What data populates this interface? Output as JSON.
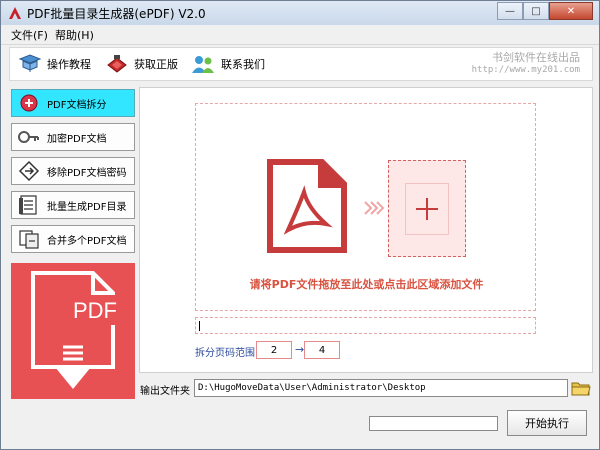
{
  "window": {
    "title": "PDF批量目录生成器(ePDF) V2.0",
    "buttons": {
      "minimize": "—",
      "maximize": "□",
      "close": "✕"
    }
  },
  "menu": [
    {
      "label": "文件(F)"
    },
    {
      "label": "帮助(H)"
    }
  ],
  "toolbar": {
    "items": [
      {
        "label": "操作教程",
        "icon": "tutorial-icon"
      },
      {
        "label": "获取正版",
        "icon": "genuine-icon"
      },
      {
        "label": "联系我们",
        "icon": "contact-icon"
      }
    ],
    "brand_name": "书剑软件在线出品",
    "brand_url": "http://www.my201.com"
  },
  "sidebar": {
    "items": [
      {
        "label": "PDF文档拆分",
        "icon": "split-icon",
        "active": true
      },
      {
        "label": "加密PDF文档",
        "icon": "key-icon",
        "active": false
      },
      {
        "label": "移除PDF文档密码",
        "icon": "unlock-icon",
        "active": false
      },
      {
        "label": "批量生成PDF目录",
        "icon": "toc-icon",
        "active": false
      },
      {
        "label": "合并多个PDF文档",
        "icon": "merge-icon",
        "active": false
      }
    ],
    "promo_text": "PDF"
  },
  "main": {
    "drop_hint": "请将PDF文件拖放至此处或点击此区域添加文件",
    "file_path_value": "",
    "range_label": "拆分页码范围",
    "range_from": "2",
    "range_to": "4",
    "range_arrow": "→"
  },
  "output": {
    "label": "输出文件夹",
    "path": "D:\\HugoMoveData\\User\\Administrator\\Desktop"
  },
  "footer": {
    "progress": 0,
    "start_label": "开始执行"
  },
  "colors": {
    "accent_red": "#e85154",
    "active_tab": "#33e6ff",
    "hint_red": "#d95340"
  }
}
